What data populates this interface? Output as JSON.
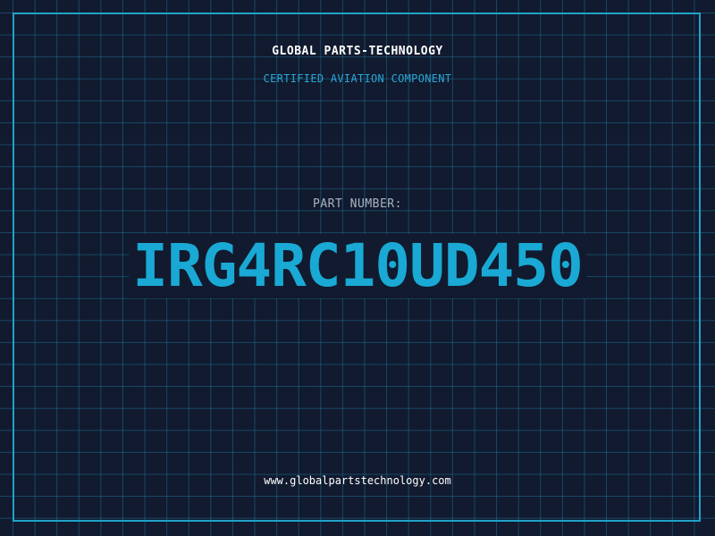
{
  "header": {
    "company": "GLOBAL PARTS-TECHNOLOGY",
    "subtitle": "CERTIFIED AVIATION COMPONENT"
  },
  "part": {
    "label": "PART NUMBER:",
    "number": "IRG4RC10UD450"
  },
  "footer": {
    "url": "www.globalpartstechnology.com"
  },
  "colors": {
    "background": "#111a2e",
    "grid": "#1e6e96",
    "frame": "#1fa3c9",
    "accent": "#19a9d4"
  }
}
